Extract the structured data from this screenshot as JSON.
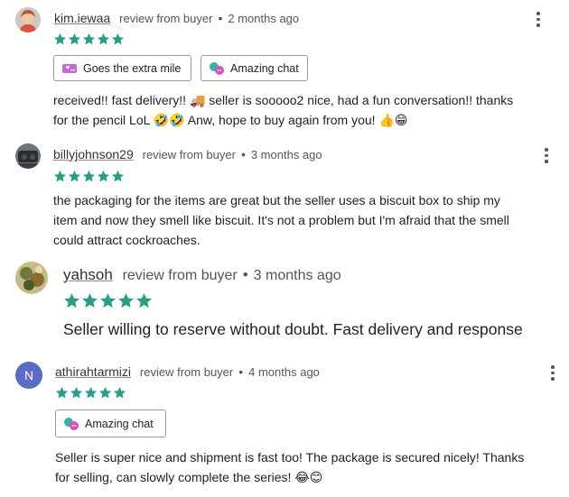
{
  "colors": {
    "star": "#2a9d85",
    "username_underline": "#888888",
    "avatar_n": "#5b6bc6"
  },
  "reviews": [
    {
      "username": "kim.iewaa",
      "type": "review from buyer",
      "time": "2 months ago",
      "rating": 5,
      "tags": [
        {
          "icon": "heart-ticket-icon",
          "label": "Goes the extra mile"
        },
        {
          "icon": "chat-bubbles-icon",
          "label": "Amazing chat"
        }
      ],
      "text_line1": "received!! fast delivery!! 🚚 seller is sooooo2 nice, had a fun conversation!! thanks",
      "text_line2": "for the pencil LoL 🤣🤣 Anw, hope to buy again from you! 👍😁"
    },
    {
      "username": "billyjohnson29",
      "type": "review from buyer",
      "time": "3 months ago",
      "rating": 5,
      "text_line1": "the packaging for the items are great but the seller uses a biscuit box to ship my",
      "text_line2": "item and now they smell like biscuit. It's not a problem but I'm afraid that the smell",
      "text_line3": "could attract cockroaches."
    },
    {
      "username": "yahsoh",
      "type": "review from buyer",
      "time": "3 months ago",
      "rating": 5,
      "text_line1": "Seller willing to reserve without doubt. Fast delivery and response"
    },
    {
      "username": "athirahtarmizi",
      "avatar_letter": "N",
      "type": "review from buyer",
      "time": "4 months ago",
      "rating": 5,
      "tags": [
        {
          "icon": "chat-bubbles-icon",
          "label": "Amazing chat"
        }
      ],
      "text_line1": "Seller is super nice and shipment is fast too! The package is secured nicely! Thanks",
      "text_line2": "for selling, can slowly complete the series! 😂😊"
    }
  ]
}
